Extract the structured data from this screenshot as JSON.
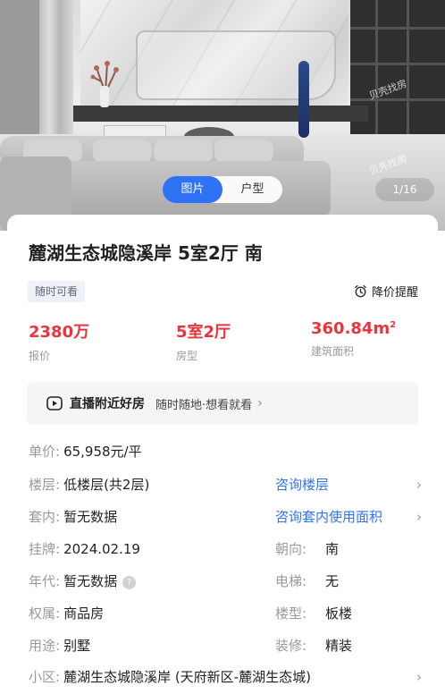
{
  "gallery": {
    "tabs": [
      {
        "label": "图片",
        "active": true
      },
      {
        "label": "户型",
        "active": false
      }
    ],
    "counter": "1/16",
    "watermark": "贝壳找房"
  },
  "listing": {
    "title": "麓湖生态城隐溪岸 5室2厅 南",
    "tag": "随时可看",
    "price_alert": "降价提醒",
    "kpis": [
      {
        "value": "2380万",
        "label": "报价"
      },
      {
        "value": "5室2厅",
        "label": "房型"
      },
      {
        "value": "360.84m",
        "sup": "2",
        "label": "建筑面积"
      }
    ],
    "live": {
      "title": "直播附近好房",
      "subtitle": "随时随地·想看就看",
      "chevron": "›"
    }
  },
  "details": {
    "unit_price": {
      "k": "单价:",
      "v": "65,958元/平"
    },
    "floor": {
      "k": "楼层:",
      "v": "低楼层(共2层)",
      "link": "咨询楼层"
    },
    "inner": {
      "k": "套内:",
      "v": "暂无数据",
      "link": "咨询套内使用面积"
    },
    "listed": {
      "k": "挂牌:",
      "v": "2024.02.19",
      "k2": "朝向:",
      "v2": "南"
    },
    "year": {
      "k": "年代:",
      "v": "暂无数据",
      "k2": "电梯:",
      "v2": "无"
    },
    "ownership": {
      "k": "权属:",
      "v": "商品房",
      "k2": "楼型:",
      "v2": "板楼"
    },
    "usage": {
      "k": "用途:",
      "v": "别墅",
      "k2": "装修:",
      "v2": "精装"
    },
    "community": {
      "k": "小区:",
      "v": "麓湖生态城隐溪岸 (天府新区-麓湖生态城)"
    }
  },
  "colors": {
    "accent": "#3072f6",
    "price": "#e8343c"
  }
}
